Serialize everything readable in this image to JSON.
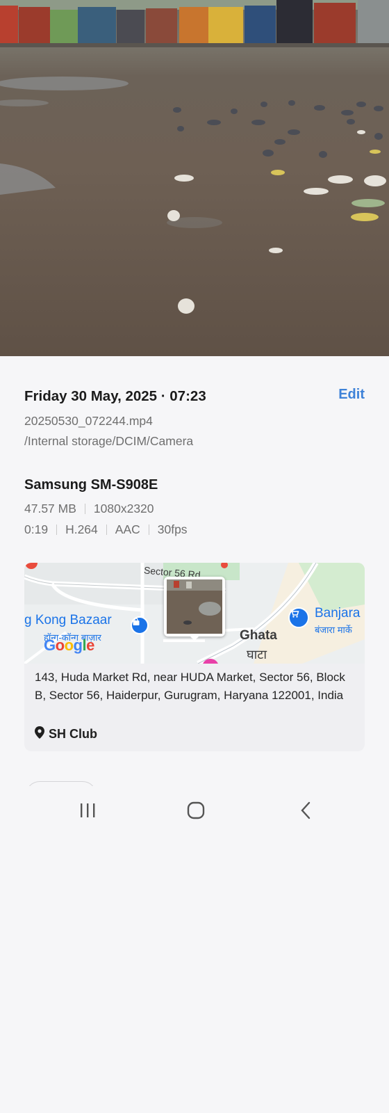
{
  "photo": {
    "subject": "muddy open ground with pigeons and market kiosks"
  },
  "details": {
    "datetime": "Friday 30 May, 2025 · 07:23",
    "edit_label": "Edit",
    "filename": "20250530_072244.mp4",
    "path": "/Internal storage/DCIM/Camera",
    "device": "Samsung SM-S908E",
    "size": "47.57 MB",
    "resolution": "1080x2320",
    "duration": "0:19",
    "video_codec": "H.264",
    "audio_codec": "AAC",
    "fps": "30fps"
  },
  "map": {
    "road_label": "Sector 56 Rd",
    "poi_left_en": "g Kong Bazaar",
    "poi_left_hi": "हॉन्ग-कॉन्ग बाज़ार",
    "poi_right_en": "Banjara",
    "poi_right_hi": "बंजारा मार्के",
    "area_en": "Ghata",
    "area_hi": "घाटा",
    "provider": "Google",
    "colors": {
      "poi_blue": "#1a73e8",
      "water": "#aadaff",
      "park": "#c8e6c9"
    }
  },
  "location": {
    "address": "143, Huda Market Rd, near HUDA Market, Sector 56, Block B, Sector 56, Haiderpur, Gurugram, Haryana 122001, India",
    "place": "SH Club"
  },
  "navbar": {
    "recent_icon": "recent-apps-icon",
    "home_icon": "home-icon",
    "back_icon": "back-icon"
  }
}
